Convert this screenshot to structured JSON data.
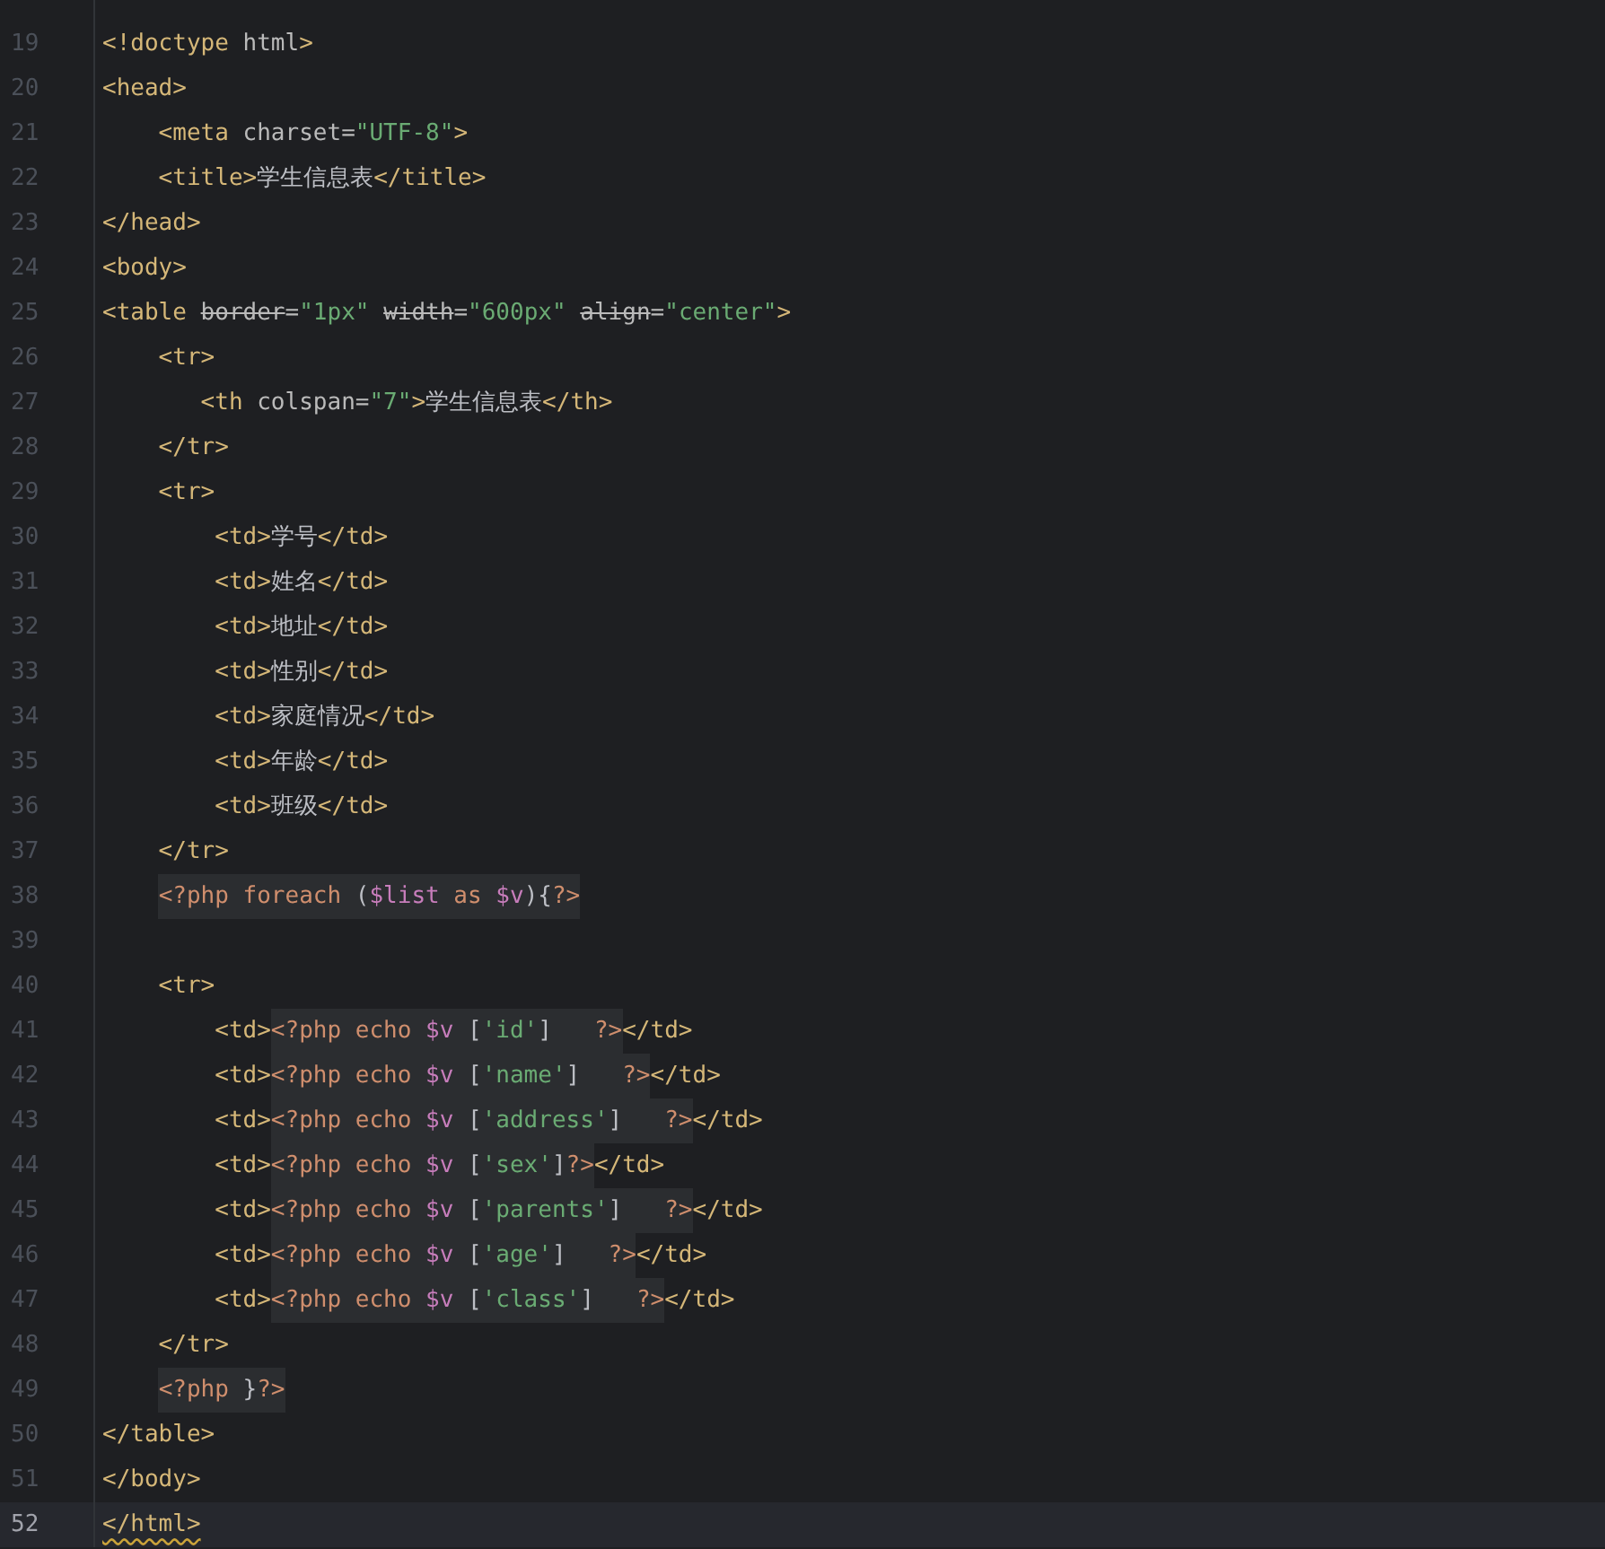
{
  "editor": {
    "lines": [
      {
        "number": "19",
        "current": false,
        "tokens": [
          {
            "kind": "tag",
            "text": "<!doctype"
          },
          {
            "kind": "attr",
            "text": " html"
          },
          {
            "kind": "tag",
            "text": ">"
          }
        ]
      },
      {
        "number": "20",
        "current": false,
        "tokens": [
          {
            "kind": "tag",
            "text": "<head>"
          }
        ]
      },
      {
        "number": "21",
        "current": false,
        "tokens": [
          {
            "kind": "tag",
            "text": "    <meta"
          },
          {
            "kind": "attr",
            "text": " charset="
          },
          {
            "kind": "string",
            "text": "\"UTF-8\""
          },
          {
            "kind": "tag",
            "text": ">"
          }
        ]
      },
      {
        "number": "22",
        "current": false,
        "tokens": [
          {
            "kind": "tag",
            "text": "    <title>"
          },
          {
            "kind": "text",
            "text": "学生信息表"
          },
          {
            "kind": "tag",
            "text": "</title>"
          }
        ]
      },
      {
        "number": "23",
        "current": false,
        "tokens": [
          {
            "kind": "tag",
            "text": "</head>"
          }
        ]
      },
      {
        "number": "24",
        "current": false,
        "tokens": [
          {
            "kind": "tag",
            "text": "<body>"
          }
        ]
      },
      {
        "number": "25",
        "current": false,
        "tokens": [
          {
            "kind": "tag",
            "text": "<table "
          },
          {
            "kind": "struck",
            "text": "border"
          },
          {
            "kind": "attr",
            "text": "="
          },
          {
            "kind": "string",
            "text": "\"1px\" "
          },
          {
            "kind": "struck",
            "text": "width"
          },
          {
            "kind": "attr",
            "text": "="
          },
          {
            "kind": "string",
            "text": "\"600px\" "
          },
          {
            "kind": "struck",
            "text": "align"
          },
          {
            "kind": "attr",
            "text": "="
          },
          {
            "kind": "string",
            "text": "\"center\""
          },
          {
            "kind": "tag",
            "text": ">"
          }
        ]
      },
      {
        "number": "26",
        "current": false,
        "tokens": [
          {
            "kind": "tag",
            "text": "    <tr>"
          }
        ]
      },
      {
        "number": "27",
        "current": false,
        "tokens": [
          {
            "kind": "tag",
            "text": "       <th"
          },
          {
            "kind": "attr",
            "text": " colspan="
          },
          {
            "kind": "string",
            "text": "\"7\""
          },
          {
            "kind": "tag",
            "text": ">"
          },
          {
            "kind": "text",
            "text": "学生信息表"
          },
          {
            "kind": "tag",
            "text": "</th>"
          }
        ]
      },
      {
        "number": "28",
        "current": false,
        "tokens": [
          {
            "kind": "tag",
            "text": "    </tr>"
          }
        ]
      },
      {
        "number": "29",
        "current": false,
        "tokens": [
          {
            "kind": "tag",
            "text": "    <tr>"
          }
        ]
      },
      {
        "number": "30",
        "current": false,
        "tokens": [
          {
            "kind": "tag",
            "text": "        <td>"
          },
          {
            "kind": "text",
            "text": "学号"
          },
          {
            "kind": "tag",
            "text": "</td>"
          }
        ]
      },
      {
        "number": "31",
        "current": false,
        "tokens": [
          {
            "kind": "tag",
            "text": "        <td>"
          },
          {
            "kind": "text",
            "text": "姓名"
          },
          {
            "kind": "tag",
            "text": "</td>"
          }
        ]
      },
      {
        "number": "32",
        "current": false,
        "tokens": [
          {
            "kind": "tag",
            "text": "        <td>"
          },
          {
            "kind": "text",
            "text": "地址"
          },
          {
            "kind": "tag",
            "text": "</td>"
          }
        ]
      },
      {
        "number": "33",
        "current": false,
        "tokens": [
          {
            "kind": "tag",
            "text": "        <td>"
          },
          {
            "kind": "text",
            "text": "性别"
          },
          {
            "kind": "tag",
            "text": "</td>"
          }
        ]
      },
      {
        "number": "34",
        "current": false,
        "tokens": [
          {
            "kind": "tag",
            "text": "        <td>"
          },
          {
            "kind": "text",
            "text": "家庭情况"
          },
          {
            "kind": "tag",
            "text": "</td>"
          }
        ]
      },
      {
        "number": "35",
        "current": false,
        "tokens": [
          {
            "kind": "tag",
            "text": "        <td>"
          },
          {
            "kind": "text",
            "text": "年龄"
          },
          {
            "kind": "tag",
            "text": "</td>"
          }
        ]
      },
      {
        "number": "36",
        "current": false,
        "tokens": [
          {
            "kind": "tag",
            "text": "        <td>"
          },
          {
            "kind": "text",
            "text": "班级"
          },
          {
            "kind": "tag",
            "text": "</td>"
          }
        ]
      },
      {
        "number": "37",
        "current": false,
        "tokens": [
          {
            "kind": "tag",
            "text": "    </tr>"
          }
        ]
      },
      {
        "number": "38",
        "current": false,
        "tokens": [
          {
            "kind": "php",
            "tokens": [
              {
                "kind": "keyword",
                "text": "    <?php foreach "
              },
              {
                "kind": "punct",
                "text": "("
              },
              {
                "kind": "var",
                "text": "$list"
              },
              {
                "kind": "keyword",
                "text": " as "
              },
              {
                "kind": "var",
                "text": "$v"
              },
              {
                "kind": "punct",
                "text": "){"
              },
              {
                "kind": "keyword",
                "text": "?>"
              }
            ]
          }
        ]
      },
      {
        "number": "39",
        "current": false
      },
      {
        "number": "40",
        "current": false,
        "tokens": [
          {
            "kind": "tag",
            "text": "    <tr>"
          }
        ]
      },
      {
        "number": "41",
        "current": false,
        "tokens": [
          {
            "kind": "tag",
            "text": "        <td>"
          },
          {
            "kind": "php",
            "tokens": [
              {
                "kind": "keyword",
                "text": "<?php echo "
              },
              {
                "kind": "var",
                "text": "$v"
              },
              {
                "kind": "punct",
                "text": " ["
              },
              {
                "kind": "string",
                "text": "'id'"
              },
              {
                "kind": "punct",
                "text": "]   "
              },
              {
                "kind": "keyword",
                "text": "?>"
              }
            ]
          },
          {
            "kind": "tag",
            "text": "</td>"
          }
        ]
      },
      {
        "number": "42",
        "current": false,
        "tokens": [
          {
            "kind": "tag",
            "text": "        <td>"
          },
          {
            "kind": "php",
            "tokens": [
              {
                "kind": "keyword",
                "text": "<?php echo "
              },
              {
                "kind": "var",
                "text": "$v"
              },
              {
                "kind": "punct",
                "text": " ["
              },
              {
                "kind": "string",
                "text": "'name'"
              },
              {
                "kind": "punct",
                "text": "]   "
              },
              {
                "kind": "keyword",
                "text": "?>"
              }
            ]
          },
          {
            "kind": "tag",
            "text": "</td>"
          }
        ]
      },
      {
        "number": "43",
        "current": false,
        "tokens": [
          {
            "kind": "tag",
            "text": "        <td>"
          },
          {
            "kind": "php",
            "tokens": [
              {
                "kind": "keyword",
                "text": "<?php echo "
              },
              {
                "kind": "var",
                "text": "$v"
              },
              {
                "kind": "punct",
                "text": " ["
              },
              {
                "kind": "string",
                "text": "'address'"
              },
              {
                "kind": "punct",
                "text": "]   "
              },
              {
                "kind": "keyword",
                "text": "?>"
              }
            ]
          },
          {
            "kind": "tag",
            "text": "</td>"
          }
        ]
      },
      {
        "number": "44",
        "current": false,
        "tokens": [
          {
            "kind": "tag",
            "text": "        <td>"
          },
          {
            "kind": "php",
            "tokens": [
              {
                "kind": "keyword",
                "text": "<?php echo "
              },
              {
                "kind": "var",
                "text": "$v"
              },
              {
                "kind": "punct",
                "text": " ["
              },
              {
                "kind": "string",
                "text": "'sex'"
              },
              {
                "kind": "punct",
                "text": "]"
              },
              {
                "kind": "keyword",
                "text": "?>"
              }
            ]
          },
          {
            "kind": "tag",
            "text": "</td>"
          }
        ]
      },
      {
        "number": "45",
        "current": false,
        "tokens": [
          {
            "kind": "tag",
            "text": "        <td>"
          },
          {
            "kind": "php",
            "tokens": [
              {
                "kind": "keyword",
                "text": "<?php echo "
              },
              {
                "kind": "var",
                "text": "$v"
              },
              {
                "kind": "punct",
                "text": " ["
              },
              {
                "kind": "string",
                "text": "'parents'"
              },
              {
                "kind": "punct",
                "text": "]   "
              },
              {
                "kind": "keyword",
                "text": "?>"
              }
            ]
          },
          {
            "kind": "tag",
            "text": "</td>"
          }
        ]
      },
      {
        "number": "46",
        "current": false,
        "tokens": [
          {
            "kind": "tag",
            "text": "        <td>"
          },
          {
            "kind": "php",
            "tokens": [
              {
                "kind": "keyword",
                "text": "<?php echo "
              },
              {
                "kind": "var",
                "text": "$v"
              },
              {
                "kind": "punct",
                "text": " ["
              },
              {
                "kind": "string",
                "text": "'age'"
              },
              {
                "kind": "punct",
                "text": "]   "
              },
              {
                "kind": "keyword",
                "text": "?>"
              }
            ]
          },
          {
            "kind": "tag",
            "text": "</td>"
          }
        ]
      },
      {
        "number": "47",
        "current": false,
        "tokens": [
          {
            "kind": "tag",
            "text": "        <td>"
          },
          {
            "kind": "php",
            "tokens": [
              {
                "kind": "keyword",
                "text": "<?php echo "
              },
              {
                "kind": "var",
                "text": "$v"
              },
              {
                "kind": "punct",
                "text": " ["
              },
              {
                "kind": "string",
                "text": "'class'"
              },
              {
                "kind": "punct",
                "text": "]   "
              },
              {
                "kind": "keyword",
                "text": "?>"
              }
            ]
          },
          {
            "kind": "tag",
            "text": "</td>"
          }
        ]
      },
      {
        "number": "48",
        "current": false,
        "tokens": [
          {
            "kind": "tag",
            "text": "    </tr>"
          }
        ]
      },
      {
        "number": "49",
        "current": false,
        "tokens": [
          {
            "kind": "php",
            "tokens": [
              {
                "kind": "keyword",
                "text": "    <?php "
              },
              {
                "kind": "punct",
                "text": "}"
              },
              {
                "kind": "keyword",
                "text": "?>"
              }
            ]
          }
        ]
      },
      {
        "number": "50",
        "current": false,
        "tokens": [
          {
            "kind": "tag",
            "text": "</table>"
          }
        ]
      },
      {
        "number": "51",
        "current": false,
        "tokens": [
          {
            "kind": "tag",
            "text": "</body>"
          }
        ]
      },
      {
        "number": "52",
        "current": true,
        "tokens": [
          {
            "kind": "tag",
            "warning": true,
            "text": "</html>"
          }
        ]
      }
    ]
  }
}
